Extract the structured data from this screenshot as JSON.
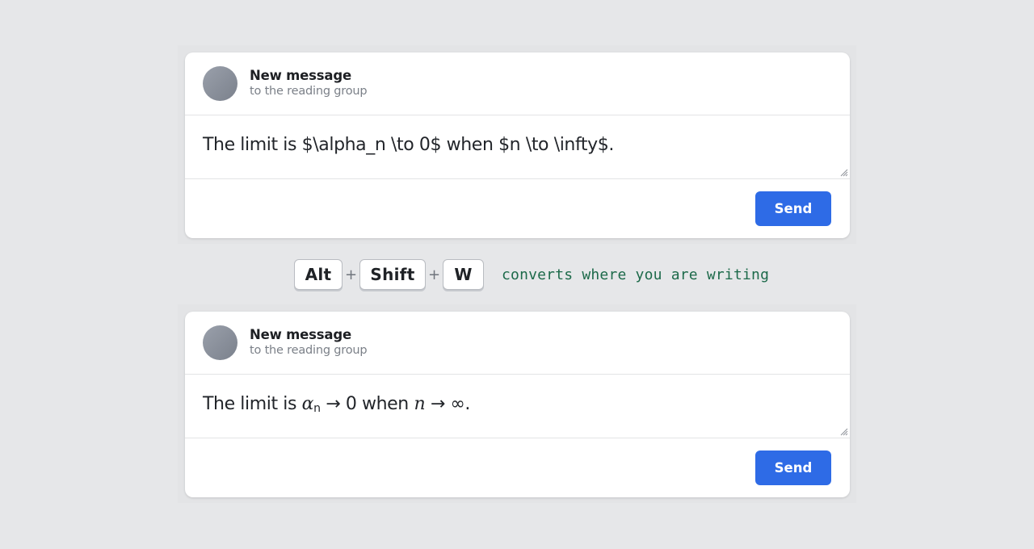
{
  "top_composer": {
    "header": {
      "title": "New message",
      "subtitle": "to the reading group"
    },
    "message_raw": "The limit is $\\alpha_n \\to 0$ when $n \\to \\infty$.",
    "send_label": "Send"
  },
  "shortcut": {
    "keys": [
      "Alt",
      "Shift",
      "W"
    ],
    "separator": "+",
    "caption": "converts where you are writing"
  },
  "bottom_composer": {
    "header": {
      "title": "New message",
      "subtitle": "to the reading group"
    },
    "message_rendered": {
      "prefix": "The limit is ",
      "alpha": "α",
      "alpha_sub": "n",
      "arrow1": " → 0 when ",
      "n_var": "n",
      "arrow2": " → ∞."
    },
    "send_label": "Send"
  },
  "colors": {
    "background": "#e6e7e9",
    "card": "#ffffff",
    "send_button": "#2e6be6",
    "caption_text": "#1d6a4a",
    "avatar": "#8a909a"
  },
  "icons": {
    "avatar": "avatar-circle",
    "resize": "resize-grip-icon"
  }
}
